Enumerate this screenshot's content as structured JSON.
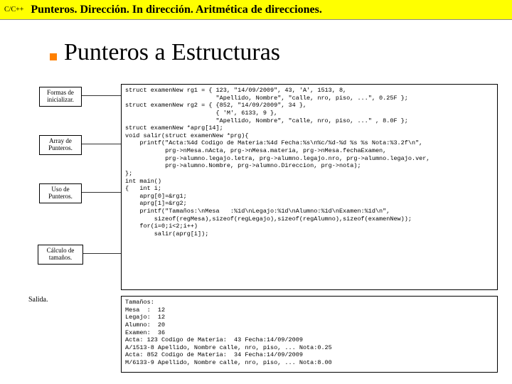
{
  "header": {
    "lang": "C/C++",
    "title": "Punteros. Dirección. In dirección. Aritmética de direcciones."
  },
  "slide_title": "Punteros a Estructuras",
  "callouts": {
    "c1": "Formas de\ninicializar.",
    "c2": "Array de\nPunteros.",
    "c3": "Uso de\nPunteros.",
    "c4": "Cálculo de\ntamaños."
  },
  "salida_label": "Salida.",
  "code": "struct examenNew rg1 = { 123, \"14/09/2009\", 43, 'A', 1513, 8,\n                         \"Apellido, Nombre\", \"calle, nro, piso, ...\", 0.25F };\nstruct examenNew rg2 = { {852, \"14/09/2009\", 34 },\n                         { 'M', 6133, 9 },\n                         \"Apellido, Nombre\", \"calle, nro, piso, ...\" , 8.0F };\nstruct examenNew *aprg[14];\nvoid salir(struct examenNew *prg){\n    printf(\"Acta:%4d Codigo de Materia:%4d Fecha:%s\\n%c/%d-%d %s %s Nota:%3.2f\\n\",\n           prg->nMesa.nActa, prg->nMesa.materia, prg->nMesa.fechaExamen,\n           prg->alumno.legajo.letra, prg->alumno.legajo.nro, prg->alumno.legajo.ver,\n           prg->alumno.Nombre, prg->alumno.Direccion, prg->nota);\n};\nint main()\n{   int i;\n    aprg[0]=&rg1;\n    aprg[1]=&rg2;\n    printf(\"Tamaños:\\nMesa   :%1d\\nLegajo:%1d\\nAlumno:%1d\\nExamen:%1d\\n\",\n        sizeof(regMesa),sizeof(regLegajo),sizeof(regAlumno),sizeof(examenNew));\n    for(i=0;i<2;i++)\n        salir(aprg[i]);\n",
  "output": "Tamaños:\nMesa  :  12\nLegajo:  12\nAlumno:  20\nExamen:  36\nActa: 123 Codigo de Materia:  43 Fecha:14/09/2009\nA/1513-8 Apellido, Nombre calle, nro, piso, ... Nota:0.25\nActa: 852 Codigo de Materia:  34 Fecha:14/09/2009\nM/6133-9 Apellido, Nombre calle, nro, piso, ... Nota:8.00"
}
